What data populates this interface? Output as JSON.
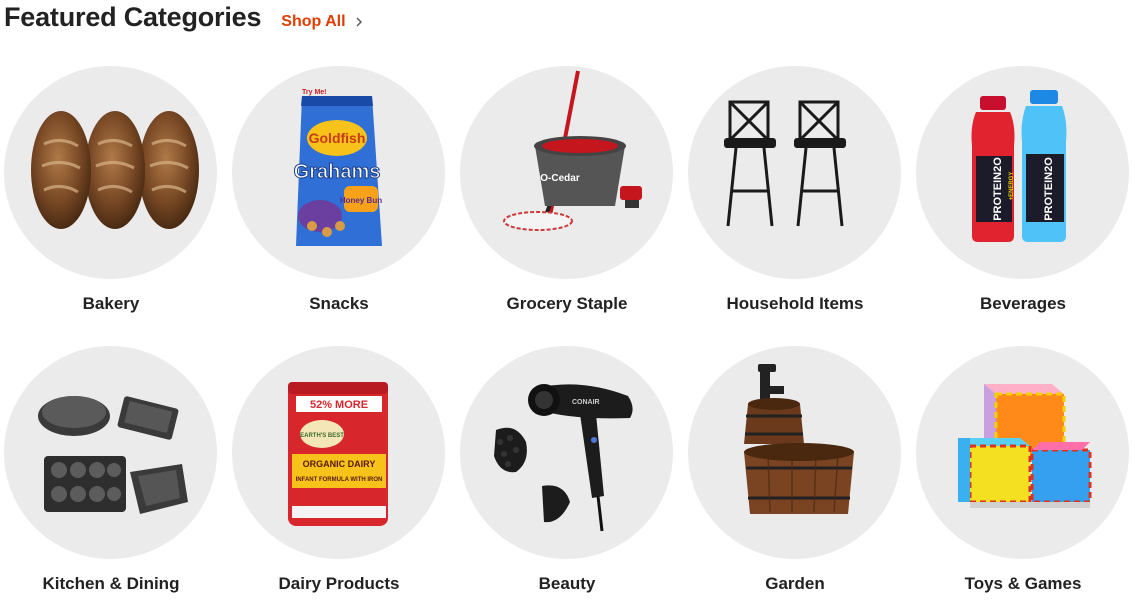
{
  "header": {
    "title": "Featured Categories",
    "shop_all": "Shop All"
  },
  "categories": [
    {
      "label": "Bakery",
      "image": "bread-loaves-icon"
    },
    {
      "label": "Snacks",
      "image": "goldfish-grahams-bag-icon"
    },
    {
      "label": "Grocery Staple",
      "image": "spin-mop-bucket-icon"
    },
    {
      "label": "Household Items",
      "image": "bar-stools-icon"
    },
    {
      "label": "Beverages",
      "image": "protein-drink-bottles-icon"
    },
    {
      "label": "Kitchen & Dining",
      "image": "bakeware-set-icon"
    },
    {
      "label": "Dairy Products",
      "image": "infant-formula-can-icon"
    },
    {
      "label": "Beauty",
      "image": "hair-dryer-icon"
    },
    {
      "label": "Garden",
      "image": "barrel-fountain-icon"
    },
    {
      "label": "Toys & Games",
      "image": "foam-blocks-icon"
    }
  ],
  "product_text": {
    "snacks_brand": "Goldfish",
    "snacks_name": "Grahams",
    "snacks_flavor": "Honey Bun",
    "snacks_tag": "Try Me!",
    "mop_brand": "O-Cedar",
    "drink_brand": "PROTEIN2O",
    "drink_sub": "+ENERGY",
    "formula_more": "52% MORE",
    "formula_brand": "EARTH'S BEST",
    "formula_line1": "ORGANIC DAIRY",
    "formula_line2": "INFANT FORMULA WITH IRON",
    "dryer_brand": "CONAIR"
  },
  "colors": {
    "accent": "#e03c00",
    "circle_bg": "#ebebeb",
    "text": "#222222"
  }
}
